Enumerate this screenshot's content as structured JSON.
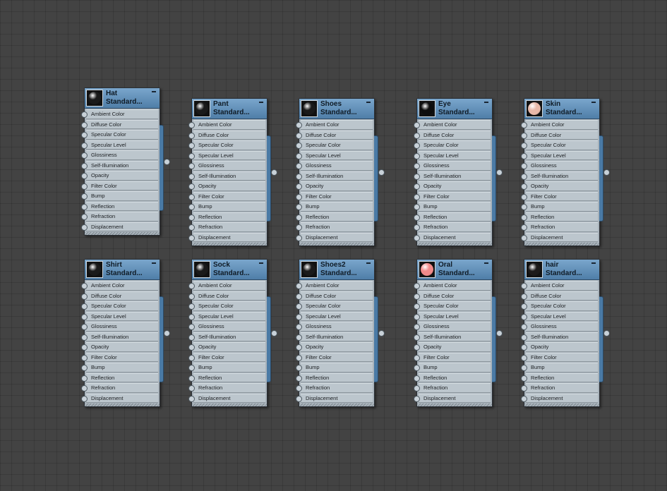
{
  "slot_labels": [
    "Ambient Color",
    "Diffuse Color",
    "Specular Color",
    "Specular Level",
    "Glossiness",
    "Self-Illumination",
    "Opacity",
    "Filter Color",
    "Bump",
    "Reflection",
    "Refraction",
    "Displacement"
  ],
  "nodes": [
    {
      "title": "Hat",
      "subtitle": "Standard...",
      "swatch_color": "#1a1a1a"
    },
    {
      "title": "Pant",
      "subtitle": "Standard...",
      "swatch_color": "#1a1a1a"
    },
    {
      "title": "Shoes",
      "subtitle": "Standard...",
      "swatch_color": "#1a1a1a"
    },
    {
      "title": "Eye",
      "subtitle": "Standard...",
      "swatch_color": "#0d0d0d"
    },
    {
      "title": "Skin",
      "subtitle": "Standard...",
      "swatch_color": "#e8b8a8"
    },
    {
      "title": "Shirt",
      "subtitle": "Standard...",
      "swatch_color": "#1a1a1a"
    },
    {
      "title": "Sock",
      "subtitle": "Standard...",
      "swatch_color": "#1a1a1a"
    },
    {
      "title": "Shoes2",
      "subtitle": "Standard...",
      "swatch_color": "#1a1a1a"
    },
    {
      "title": "Oral",
      "subtitle": "Standard...",
      "swatch_color": "#f08a8a"
    },
    {
      "title": "hair",
      "subtitle": "Standard...",
      "swatch_color": "#1c1a1a"
    }
  ]
}
